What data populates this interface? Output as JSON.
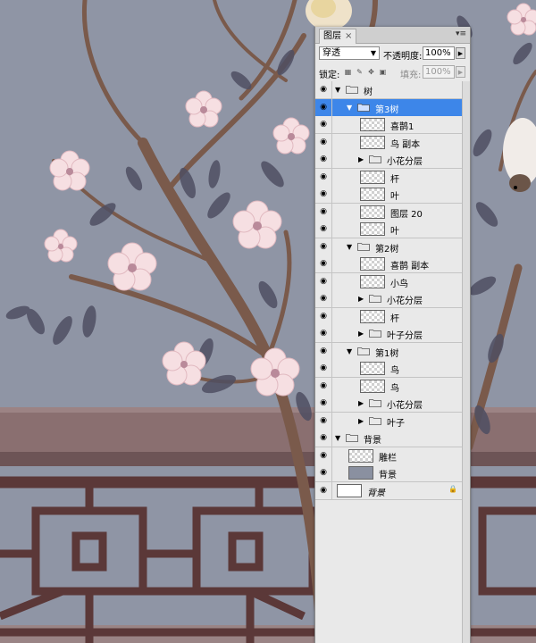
{
  "colors": {
    "background": "#8f95a5",
    "fence": "#5b3838",
    "wall": "#8a6f70",
    "blossom": "#f6dfe2",
    "selection": "#3d86e9"
  },
  "panel": {
    "tab_label": "图层",
    "tab_close": "×",
    "menu_icon": "panel-menu-icon",
    "blend_mode": "穿透",
    "opacity_label": "不透明度:",
    "opacity_value": "100%",
    "lock_label": "锁定:",
    "fill_label": "填充:",
    "fill_value": "100%"
  },
  "layers": [
    {
      "name": "树",
      "type": "group",
      "indent": 0,
      "expanded": true
    },
    {
      "name": "第3树",
      "type": "group",
      "indent": 1,
      "expanded": true,
      "selected": true
    },
    {
      "name": "喜鹊1",
      "type": "layer",
      "indent": 2
    },
    {
      "name": "鸟 副本",
      "type": "layer",
      "indent": 2
    },
    {
      "name": "小花分层",
      "type": "group",
      "indent": 2,
      "expanded": false
    },
    {
      "name": "杆",
      "type": "layer",
      "indent": 2
    },
    {
      "name": "叶",
      "type": "layer",
      "indent": 2
    },
    {
      "name": "图层 20",
      "type": "layer",
      "indent": 2
    },
    {
      "name": "叶",
      "type": "layer",
      "indent": 2
    },
    {
      "name": "第2树",
      "type": "group",
      "indent": 1,
      "expanded": true
    },
    {
      "name": "喜鹊 副本",
      "type": "layer",
      "indent": 2
    },
    {
      "name": "小鸟",
      "type": "layer",
      "indent": 2
    },
    {
      "name": "小花分层",
      "type": "group",
      "indent": 2,
      "expanded": false
    },
    {
      "name": "杆",
      "type": "layer",
      "indent": 2
    },
    {
      "name": "叶子分层",
      "type": "group",
      "indent": 2,
      "expanded": false
    },
    {
      "name": "第1树",
      "type": "group",
      "indent": 1,
      "expanded": true
    },
    {
      "name": "鸟",
      "type": "layer",
      "indent": 2
    },
    {
      "name": "鸟",
      "type": "layer",
      "indent": 2
    },
    {
      "name": "小花分层",
      "type": "group",
      "indent": 2,
      "expanded": false
    },
    {
      "name": "叶子",
      "type": "group",
      "indent": 2,
      "expanded": false
    },
    {
      "name": "背景",
      "type": "group",
      "indent": 0,
      "expanded": true
    },
    {
      "name": "雕栏",
      "type": "layer",
      "indent": 1
    },
    {
      "name": "背景",
      "type": "layer",
      "indent": 1,
      "thumb": "solid"
    },
    {
      "name": "背景",
      "type": "background",
      "indent": 0,
      "thumb": "white",
      "italic": true,
      "locked": true
    }
  ]
}
